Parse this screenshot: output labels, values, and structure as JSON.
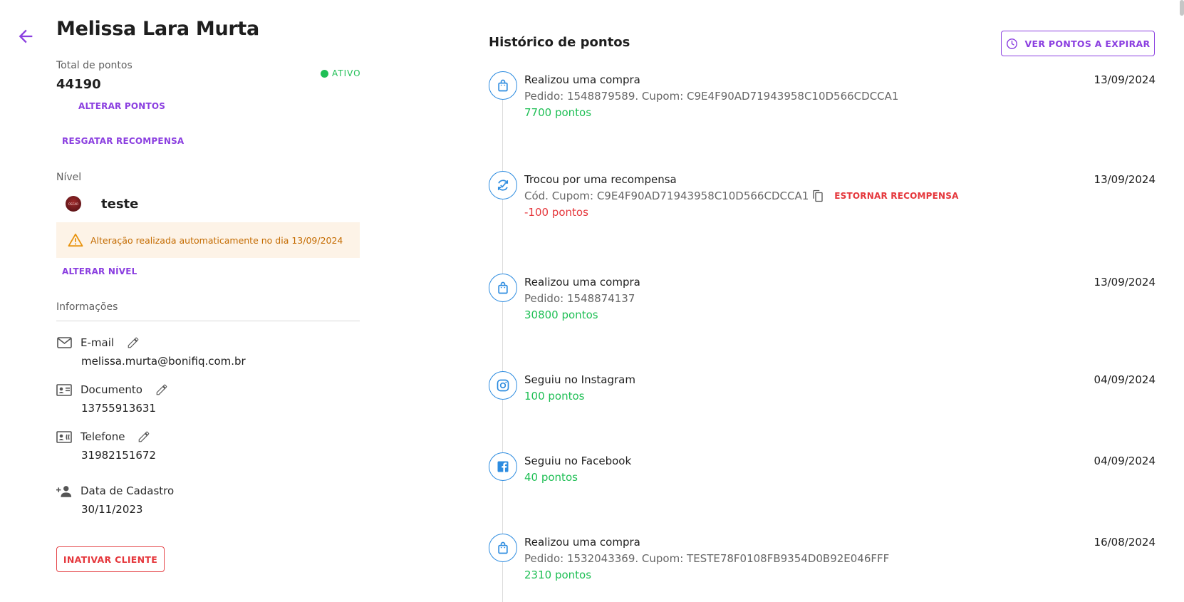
{
  "customer": {
    "name": "Melissa Lara Murta",
    "total_label": "Total de pontos",
    "total_points": "44190",
    "status": "ATIVO",
    "alter_points_label": "ALTERAR PONTOS",
    "redeem_label": "RESGATAR RECOMPENSA",
    "level_label": "Nível",
    "level_name": "teste",
    "level_badge_text": "OSCAR",
    "level_alert": "Alteração realizada automaticamente no dia 13/09/2024",
    "alter_level_label": "ALTERAR NÍVEL",
    "info_label": "Informações",
    "info": {
      "email_label": "E-mail",
      "email": "melissa.murta@bonifiq.com.br",
      "document_label": "Documento",
      "document": "13755913631",
      "phone_label": "Telefone",
      "phone": "31982151672",
      "signup_label": "Data de Cadastro",
      "signup": "30/11/2023"
    },
    "deactivate_label": "INATIVAR CLIENTE"
  },
  "history": {
    "title": "Histórico de pontos",
    "expire_button": "VER PONTOS A EXPIRAR",
    "events": [
      {
        "icon": "shopping-bag-icon",
        "title": "Realizou uma compra",
        "detail": "Pedido: 1548879589. Cupom: C9E4F90AD71943958C10D566CDCCA1",
        "points": "7700 pontos",
        "date": "13/09/2024"
      },
      {
        "icon": "exchange-icon",
        "title": "Trocou por uma recompensa",
        "detail": "Cód. Cupom: C9E4F90AD71943958C10D566CDCCA1",
        "action": "ESTORNAR RECOMPENSA",
        "points": "-100 pontos",
        "date": "13/09/2024"
      },
      {
        "icon": "shopping-bag-icon",
        "title": "Realizou uma compra",
        "detail": "Pedido: 1548874137",
        "points": "30800 pontos",
        "date": "13/09/2024"
      },
      {
        "icon": "instagram-icon",
        "title": "Seguiu no Instagram",
        "points": "100 pontos",
        "date": "04/09/2024"
      },
      {
        "icon": "facebook-icon",
        "title": "Seguiu no Facebook",
        "points": "40 pontos",
        "date": "04/09/2024"
      },
      {
        "icon": "shopping-bag-icon",
        "title": "Realizou uma compra",
        "detail": "Pedido: 1532043369. Cupom: TESTE78F0108FB9354D0B92E046FFF",
        "points": "2310 pontos",
        "date": "16/08/2024"
      }
    ]
  },
  "colors": {
    "accent": "#8b3fe0",
    "positive": "#1fbf55",
    "negative": "#e5373c",
    "icon_blue": "#2d8ce0",
    "warning": "#c46b00"
  }
}
